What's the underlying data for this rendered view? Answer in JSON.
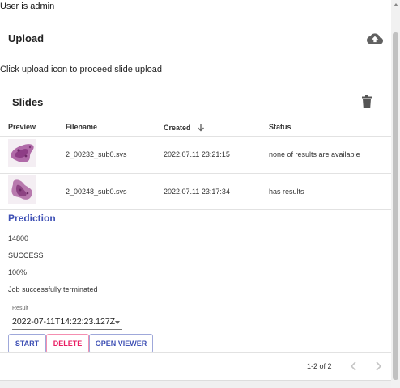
{
  "user_text": "User is admin",
  "upload": {
    "title": "Upload",
    "hint": "Click upload icon to proceed slide upload",
    "icon": "cloud-upload-icon"
  },
  "slides": {
    "title": "Slides",
    "delete_icon": "trash-icon",
    "columns": {
      "preview": "Preview",
      "filename": "Filename",
      "created": "Created",
      "status": "Status"
    },
    "sort_icon": "arrow-down-icon",
    "rows": [
      {
        "filename": "2_00232_sub0.svs",
        "created": "2022.07.11 23:21:15",
        "status": "none of results are available"
      },
      {
        "filename": "2_00248_sub0.svs",
        "created": "2022.07.11 23:17:34",
        "status": "has results"
      }
    ]
  },
  "prediction": {
    "title": "Prediction",
    "job_id": "14800",
    "state": "SUCCESS",
    "progress": "100%",
    "message": "Job successfully terminated",
    "result_label": "Result",
    "result_value": "2022-07-11T14:22:23.127Z"
  },
  "actions": {
    "start": "START",
    "delete": "DELETE",
    "open_viewer": "OPEN VIEWER"
  },
  "pagination": {
    "text": "1-2 of 2"
  },
  "colors": {
    "primary": "#3f51b5",
    "danger": "#e91e63"
  }
}
